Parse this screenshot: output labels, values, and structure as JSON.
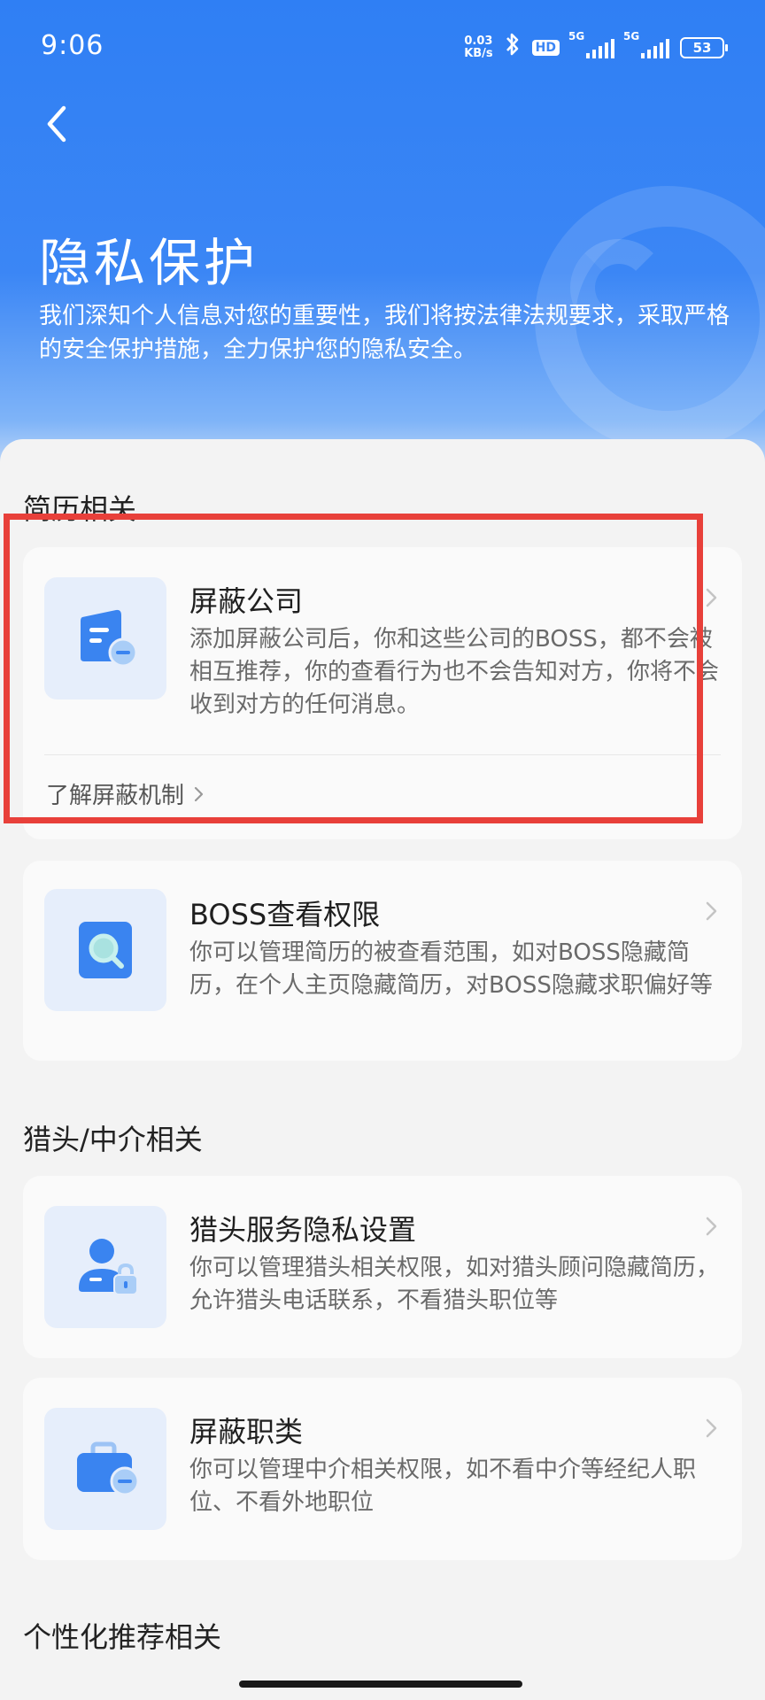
{
  "status_bar": {
    "time": "9:06",
    "net_speed_value": "0.03",
    "net_speed_unit": "KB/s",
    "hd_label": "HD",
    "signal1_label": "5G",
    "signal2_label": "5G",
    "battery": "53"
  },
  "header": {
    "title": "隐私保护",
    "description": "我们深知个人信息对您的重要性，我们将按法律法规要求，采取严格的安全保护措施，全力保护您的隐私安全。"
  },
  "sections": [
    {
      "title": "简历相关",
      "cards": [
        {
          "title": "屏蔽公司",
          "description": "添加屏蔽公司后，你和这些公司的BOSS，都不会被相互推荐，你的查看行为也不会告知对方，你将不会收到对方的任何消息。",
          "link": "了解屏蔽机制",
          "icon": "block-company-icon"
        },
        {
          "title": "BOSS查看权限",
          "description": "你可以管理简历的被查看范围，如对BOSS隐藏简历，在个人主页隐藏简历，对BOSS隐藏求职偏好等",
          "icon": "search-document-icon"
        }
      ]
    },
    {
      "title": "猎头/中介相关",
      "cards": [
        {
          "title": "猎头服务隐私设置",
          "description": "你可以管理猎头相关权限，如对猎头顾问隐藏简历，允许猎头电话联系，不看猎头职位等",
          "icon": "user-lock-icon"
        },
        {
          "title": "屏蔽职类",
          "description": "你可以管理中介相关权限，如不看中介等经纪人职位、不看外地职位",
          "icon": "block-job-icon"
        }
      ]
    },
    {
      "title": "个性化推荐相关"
    }
  ],
  "colors": {
    "primary": "#2f7ff4",
    "icon_blue": "#3a84f0",
    "highlight": "#e8403a"
  }
}
